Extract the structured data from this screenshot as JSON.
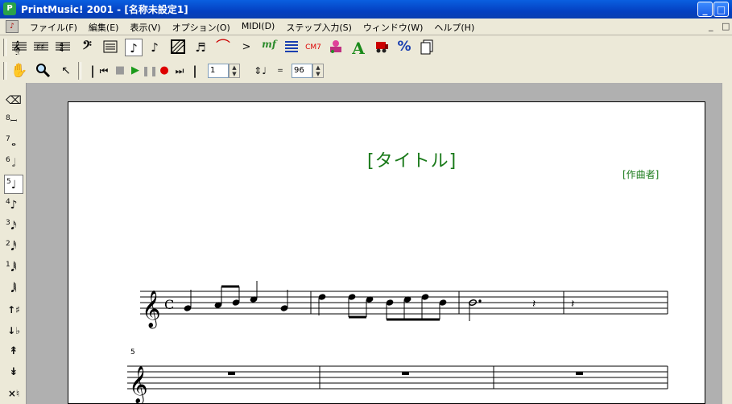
{
  "window": {
    "app_icon": "P",
    "title": "PrintMusic! 2001 - [名称未設定1]",
    "minimize_glyph": "_",
    "maximize_glyph": "□"
  },
  "menubar": {
    "doc_icon": "♪",
    "items": [
      "ファイル(F)",
      "編集(E)",
      "表示(V)",
      "オプション(O)",
      "MIDI(D)",
      "ステップ入力(S)",
      "ウィンドウ(W)",
      "ヘルプ(H)"
    ],
    "child_minimize": "_",
    "child_restore": "□"
  },
  "toolbar1": {
    "icons": [
      "treble-clef-staff-tool-icon",
      "key-signature-tool-icon",
      "time-signature-tool-icon",
      "bass-clef-tool-icon",
      "staff-tool-icon",
      "simple-entry-note-icon",
      "tuplet-tool-icon",
      "measure-tool-icon",
      "speedy-entry-icon",
      "slur-tool-icon",
      "articulation-tool-icon",
      "expression-mf-icon",
      "repeat-tool-icon",
      "chord-cm7-icon",
      "lyrics-tool-icon",
      "text-a-icon",
      "mass-edit-tool-icon",
      "resize-percent-icon",
      "page-layout-icon"
    ],
    "expression_label": "mf",
    "chord_label": "CM7",
    "text_label": "A",
    "resize_label": "%"
  },
  "toolbar2": {
    "measure_value": "1",
    "tempo_value": "96",
    "tempo_equals": "="
  },
  "palette": {
    "numbers": [
      "8",
      "7",
      "6",
      "5",
      "4",
      "3",
      "2",
      "1"
    ],
    "selected_index": 3
  },
  "score": {
    "title": "[タイトル]",
    "composer": "[作曲者]",
    "measure_number": "5"
  },
  "colors": {
    "title_green": "#1a7a1a",
    "titlebar_blue": "#0441c2",
    "workspace_gray": "#b0b0b0"
  }
}
